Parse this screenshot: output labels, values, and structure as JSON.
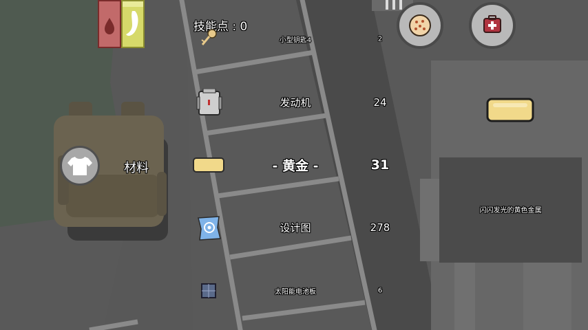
{
  "skill_points": "技能点 : 0",
  "category_label": "材料",
  "items": [
    {
      "name": "小型钥匙4",
      "count": "2",
      "icon": "key-icon"
    },
    {
      "name": "发动机",
      "count": "24",
      "icon": "engine-icon"
    },
    {
      "name": "- 黄金 -",
      "count": "31",
      "icon": "gold-bar-icon",
      "selected": true
    },
    {
      "name": "设计图",
      "count": "278",
      "icon": "blueprint-icon"
    },
    {
      "name": "太阳能电池板",
      "count": "6",
      "icon": "solar-panel-icon"
    }
  ],
  "description": "闪闪发光的黄色金属",
  "status": {
    "blood_color": "#c26a6a",
    "stomach_color": "#d6d96a"
  },
  "buttons": {
    "food": "cookie-icon",
    "medkit": "medkit-icon",
    "clothing": "shirt-icon"
  }
}
